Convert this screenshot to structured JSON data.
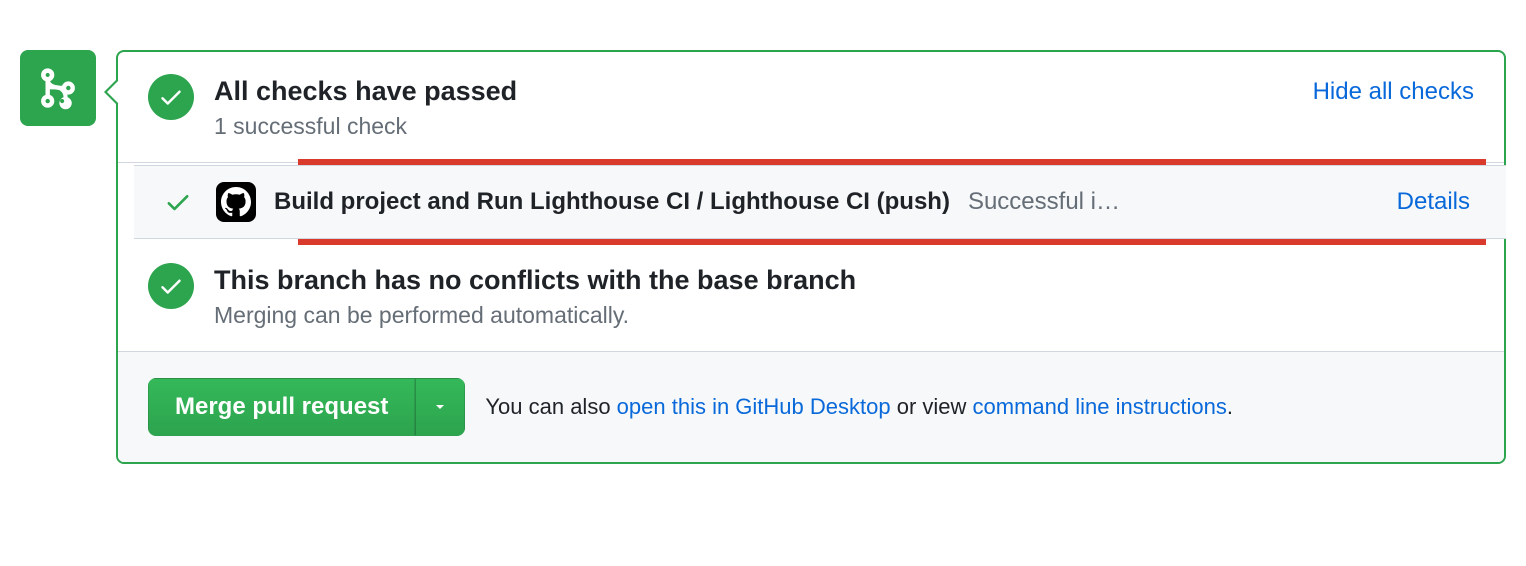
{
  "checks": {
    "title": "All checks have passed",
    "subtitle": "1 successful check",
    "toggle_label": "Hide all checks",
    "items": [
      {
        "name": "Build project and Run Lighthouse CI / Lighthouse CI (push)",
        "status_text": "Successful i…",
        "details_label": "Details"
      }
    ]
  },
  "conflicts": {
    "title": "This branch has no conflicts with the base branch",
    "subtitle": "Merging can be performed automatically."
  },
  "merge": {
    "button_label": "Merge pull request",
    "helper_prefix": "You can also ",
    "desktop_link": "open this in GitHub Desktop",
    "helper_middle": " or view ",
    "cli_link": "command line instructions",
    "helper_suffix": "."
  }
}
